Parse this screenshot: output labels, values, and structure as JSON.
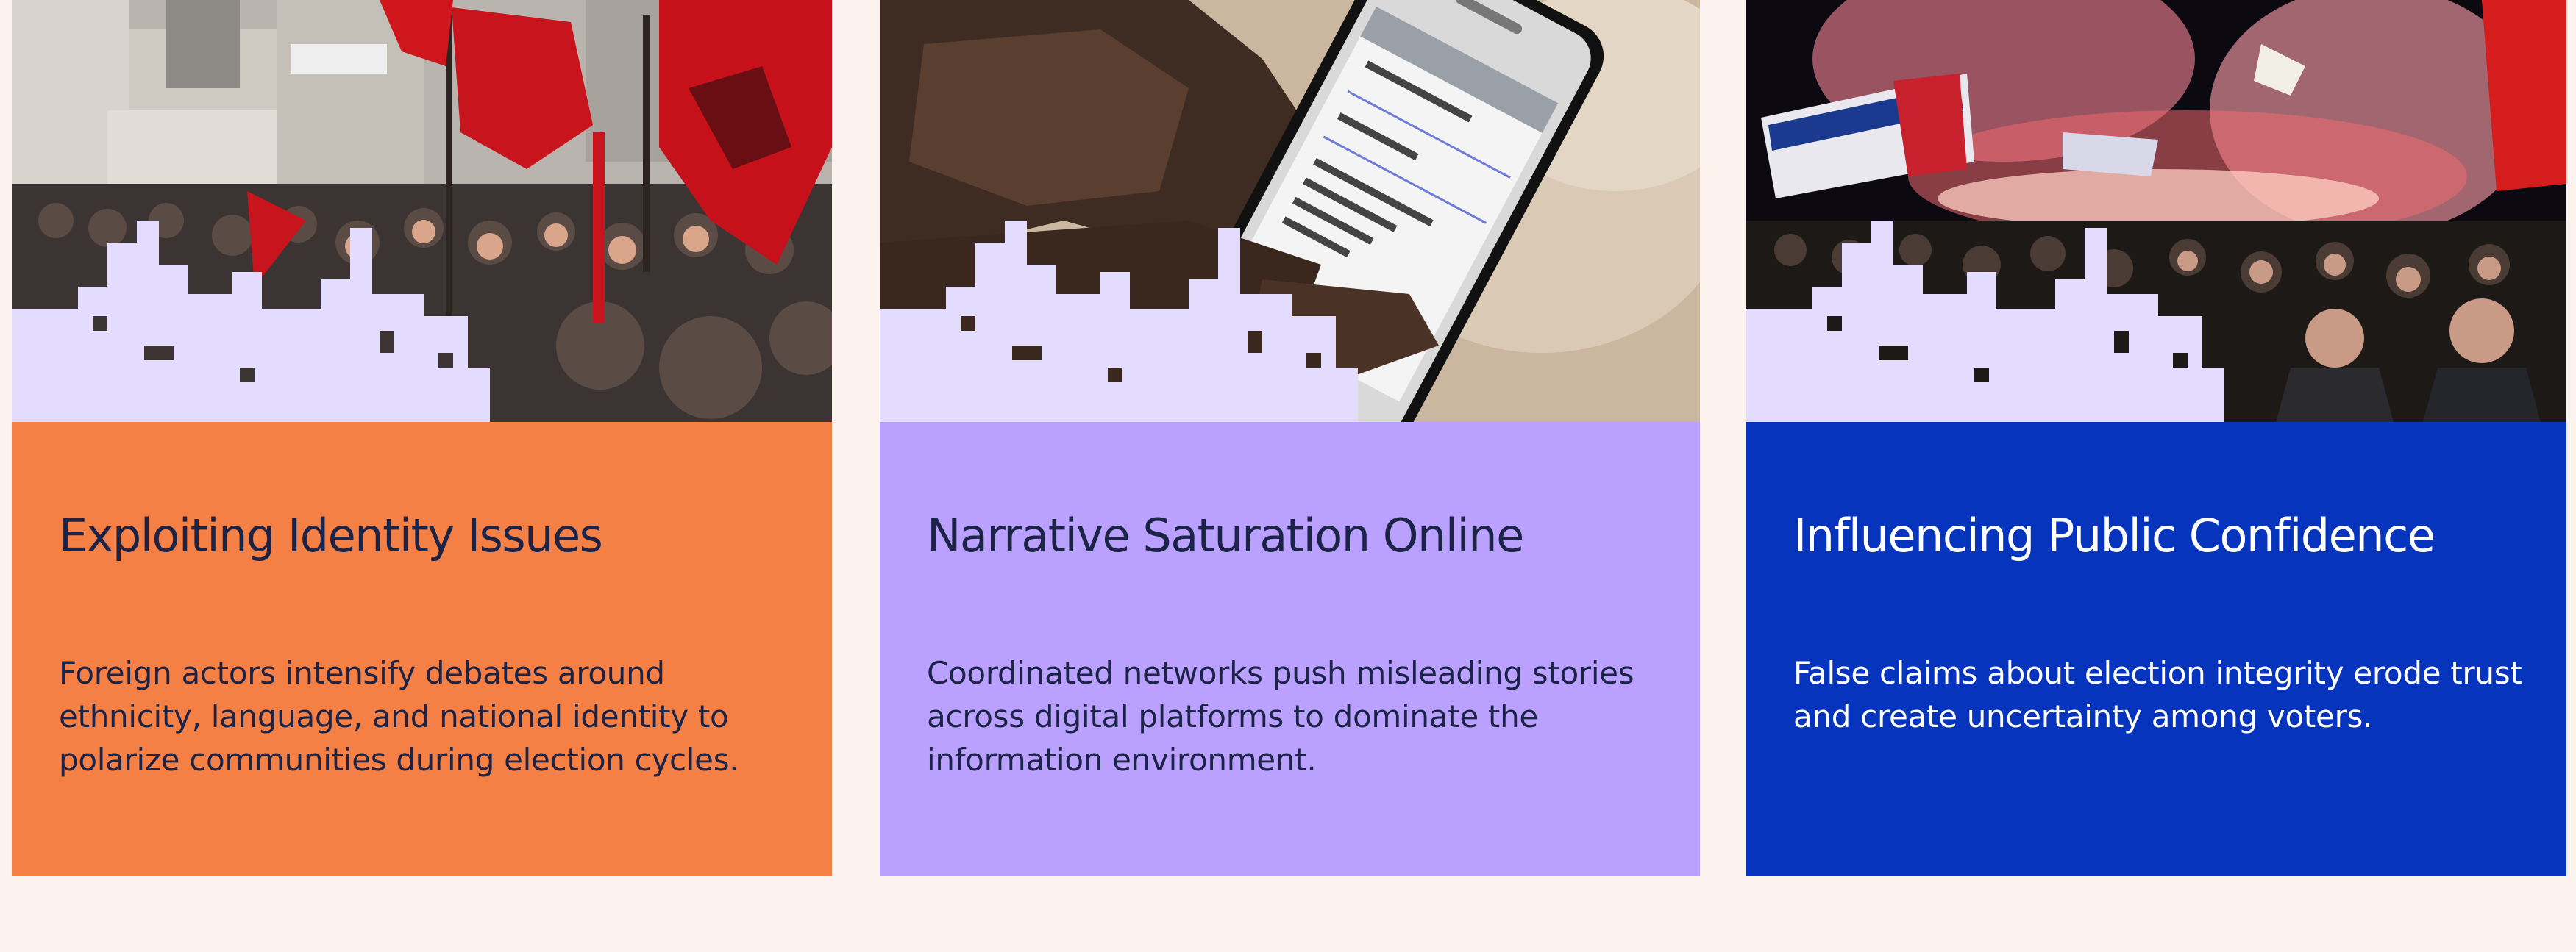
{
  "colors": {
    "page_background": "#fdf3ee",
    "pixel_overlay": "#e4dcff",
    "ink_dark": "#1b2346",
    "ink_light": "#ffffff"
  },
  "cards": [
    {
      "title": "Exploiting Identity Issues",
      "description": "Foreign actors intensify debates around ethnicity, language, and national identity to polarize communities during election cycles.",
      "panel_color": "#f58045",
      "text_color": "#1b2346",
      "image_subject": "crowd waving red Albanian flags"
    },
    {
      "title": "Narrative Saturation Online",
      "description": "Coordinated networks push misleading stories across digital platforms to dominate the information environment.",
      "panel_color": "#bba1ff",
      "text_color": "#1b2346",
      "image_subject": "hand holding Samsung smartphone with a form"
    },
    {
      "title": "Influencing Public Confidence",
      "description": "False claims about election integrity erode trust and create uncertainty among voters.",
      "panel_color": "#0634bd",
      "text_color": "#ffffff",
      "image_subject": "night rally with flares and banners"
    }
  ]
}
